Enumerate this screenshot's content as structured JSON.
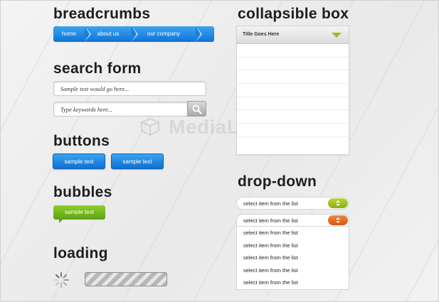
{
  "headings": {
    "breadcrumbs": "breadcrumbs",
    "search_form": "search form",
    "buttons": "buttons",
    "bubbles": "bubbles",
    "loading": "loading",
    "collapsible_box": "collapsible box",
    "drop_down": "drop-down"
  },
  "breadcrumbs": {
    "items": [
      "home",
      "about us",
      "our company"
    ],
    "color": "#1a80dd"
  },
  "search": {
    "field1_placeholder": "Sample text would go here...",
    "field2_placeholder": "Type keywords here...",
    "button_icon": "search-icon"
  },
  "buttons": {
    "labels": [
      "sample text",
      "sample text"
    ],
    "color": "#1a7fe0"
  },
  "bubble": {
    "label": "sample text",
    "color": "#6cb01e"
  },
  "loading": {
    "spinner_icon": "spinner-icon",
    "progress_style": "striped"
  },
  "watermark": {
    "text": "MediaLoot"
  },
  "collapsible": {
    "title": "Title Goes Here",
    "toggle_icon": "triangle-down-icon",
    "row_count": 8,
    "accent": "#9cbf1e"
  },
  "dropdowns": {
    "first": {
      "value": "select item from the list",
      "toggle_color": "#a2c21a"
    },
    "second": {
      "value": "select item from the list",
      "toggle_color": "#e3641b"
    },
    "options": [
      "select item from the list",
      "select item from the list",
      "select item from the list",
      "select item from the list",
      "select item from the list"
    ]
  }
}
